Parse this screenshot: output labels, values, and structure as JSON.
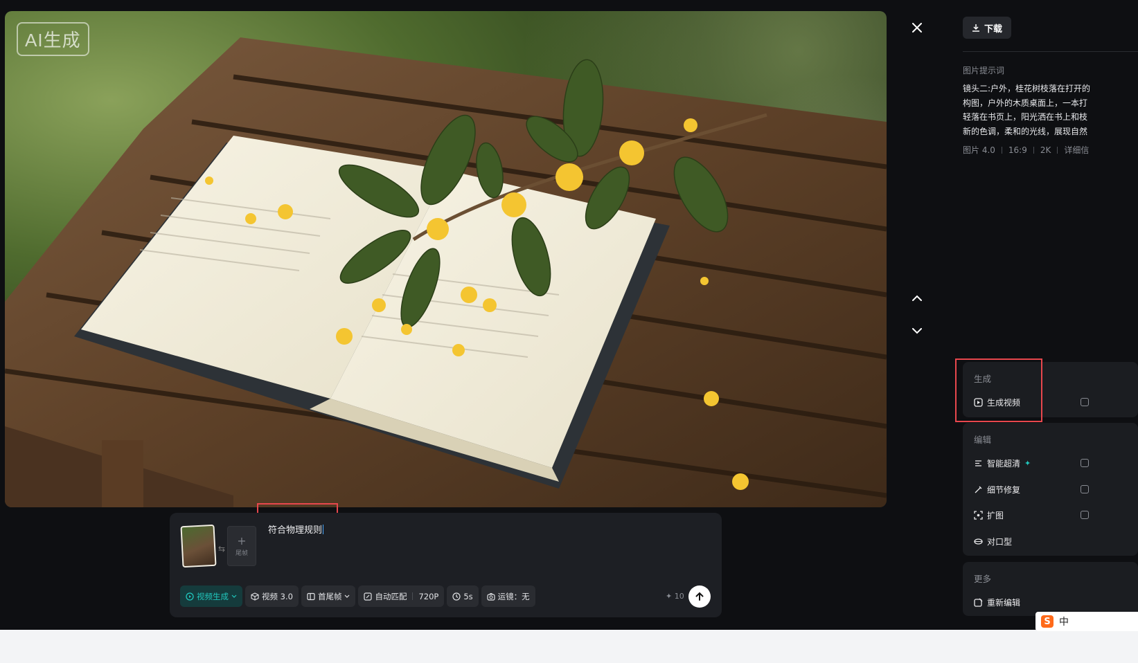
{
  "stage": {
    "badge": "AI生成"
  },
  "panel": {
    "download_label": "下载",
    "prompt_title": "图片提示词",
    "prompt_text": "镜头二:户外，桂花树枝落在打开的\n构图，户外的木质桌面上，一本打\n轻落在书页上，阳光洒在书上和枝\n新的色调，柔和的光线，展现自然",
    "meta": [
      "图片 4.0",
      "16:9",
      "2K",
      "详细信"
    ],
    "generate": {
      "title": "生成",
      "items": [
        {
          "label": "生成视频",
          "icon": "play-square-icon"
        }
      ]
    },
    "edit": {
      "title": "编辑",
      "items": [
        {
          "label": "智能超清",
          "icon": "hd-icon",
          "badge": "✦"
        },
        {
          "label": "细节修复",
          "icon": "wand-icon"
        },
        {
          "label": "扩图",
          "icon": "expand-icon"
        },
        {
          "label": "对口型",
          "icon": "lip-icon"
        }
      ]
    },
    "more": {
      "title": "更多",
      "items": [
        {
          "label": "重新编辑",
          "icon": "re-edit-icon"
        }
      ]
    }
  },
  "composer": {
    "end_frame_label": "尾帧",
    "input_text": "符合物理规则",
    "chips": {
      "mode": "视频生成",
      "model": "视频 3.0",
      "frames": "首尾帧",
      "ratio": "自动匹配",
      "resolution": "720P",
      "duration": "5s",
      "camera": "运镜：无"
    },
    "credits": "10"
  },
  "ime": {
    "logo": "S",
    "lang": "中"
  },
  "colors": {
    "accent_teal": "#21c7bd",
    "highlight_red": "#e8474d",
    "background": "#0e0f12"
  }
}
